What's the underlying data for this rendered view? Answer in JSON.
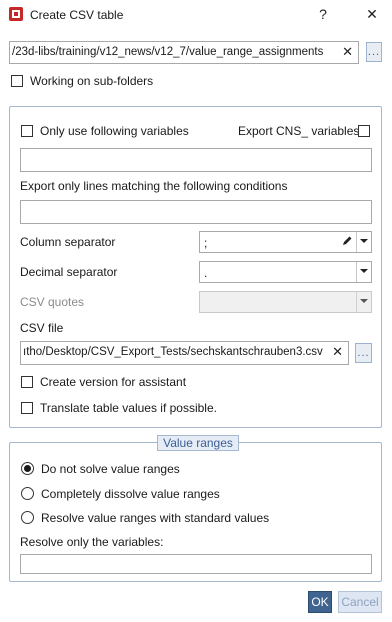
{
  "window": {
    "title": "Create CSV table",
    "help_glyph": "?",
    "close_glyph": "✕"
  },
  "path_field": {
    "value": "/23d-libs/training/v12_news/v12_7/value_range_assignments",
    "clear_glyph": "✕",
    "browse_label": "..."
  },
  "working_subfolders": {
    "label": "Working on sub-folders",
    "checked": false
  },
  "export_group": {
    "only_vars_label": "Only use following variables",
    "only_vars_checked": false,
    "export_cns_label": "Export CNS_ variables",
    "export_cns_checked": false,
    "variables_value": "",
    "conditions_label": "Export only lines matching the following conditions",
    "conditions_value": "",
    "column_sep_label": "Column separator",
    "column_sep_value": ";",
    "decimal_sep_label": "Decimal separator",
    "decimal_sep_value": ".",
    "csv_quotes_label": "CSV quotes",
    "csv_quotes_value": "",
    "csv_file_label": "CSV file",
    "csv_file_value": "ıtho/Desktop/CSV_Export_Tests/sechskantschrauben3.csv",
    "csv_file_clear": "✕",
    "csv_file_browse": "...",
    "create_version_label": "Create version for assistant",
    "create_version_checked": false,
    "translate_label": "Translate table values if possible.",
    "translate_checked": false
  },
  "value_ranges": {
    "legend": "Value ranges",
    "options": [
      {
        "label": "Do not solve value ranges",
        "selected": true
      },
      {
        "label": "Completely dissolve value ranges",
        "selected": false
      },
      {
        "label": "Resolve value ranges with standard values",
        "selected": false
      }
    ],
    "resolve_vars_label": "Resolve only the variables:",
    "resolve_vars_value": ""
  },
  "buttons": {
    "ok": "OK",
    "cancel": "Cancel"
  },
  "colors": {
    "accent": "#3f648f",
    "group_border": "#a6b8d0",
    "app_icon": "#c62828"
  }
}
